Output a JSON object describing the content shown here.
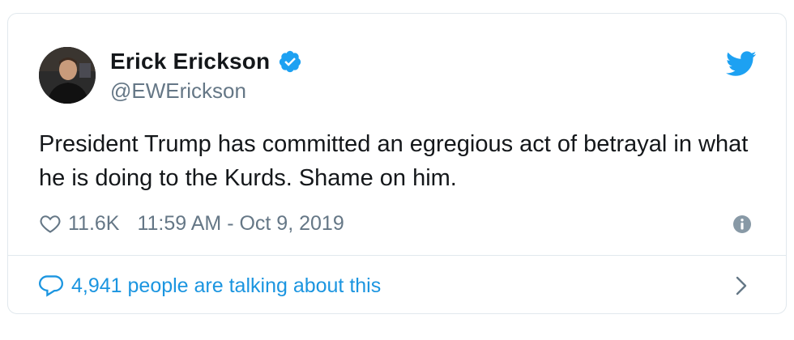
{
  "author": {
    "name": "Erick Erickson",
    "handle": "@EWErickson",
    "verified_icon": "verified-badge-icon",
    "avatar_icon": "avatar-photo"
  },
  "tweet": {
    "text": "President Trump has committed an egregious act of betrayal in what he is doing to the Kurds. Shame on him."
  },
  "meta": {
    "likes": "11.6K",
    "timestamp": "11:59 AM - Oct 9, 2019"
  },
  "footer": {
    "conversation_text": "4,941 people are talking about this"
  },
  "colors": {
    "accent": "#1da1f2",
    "link": "#1b95e0",
    "secondary_text": "#657786",
    "primary_text": "#14171a",
    "border": "#e1e8ed"
  },
  "icons": {
    "brand": "twitter-bird-icon",
    "like": "heart-icon",
    "info": "info-icon",
    "reply": "speech-bubble-icon",
    "more": "chevron-right-icon"
  }
}
